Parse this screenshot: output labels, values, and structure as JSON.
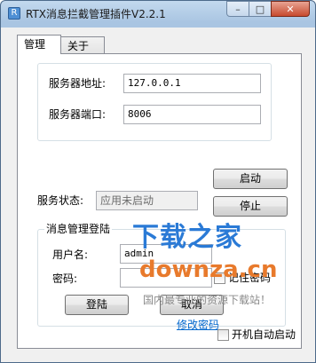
{
  "window": {
    "title": "RTX消息拦截管理插件V2.2.1",
    "icon": "app-icon",
    "accent": "#a9c5e2"
  },
  "caption": {
    "minimize": "–",
    "maximize": "□",
    "close": "✕"
  },
  "tabs": [
    {
      "label": "管理",
      "active": true
    },
    {
      "label": "关于",
      "active": false
    }
  ],
  "server": {
    "address_label": "服务器地址:",
    "address_value": "127.0.0.1",
    "port_label": "服务器端口:",
    "port_value": "8006"
  },
  "actions": {
    "start": "启动",
    "stop": "停止"
  },
  "status": {
    "label": "服务状态:",
    "value": "应用未启动"
  },
  "login": {
    "group_title": "消息管理登陆",
    "user_label": "用户名:",
    "user_value": "admin",
    "pwd_label": "密码:",
    "pwd_value": "",
    "remember_label": "记住密码",
    "login_btn": "登陆",
    "cancel_btn": "取消",
    "change_pwd": "修改密码"
  },
  "autostart": {
    "label": "开机自动启动",
    "checked": false
  },
  "watermark": {
    "line1": "下载之家",
    "line2": "downza.cn",
    "line3": "国内最专业的资源下载站！"
  }
}
